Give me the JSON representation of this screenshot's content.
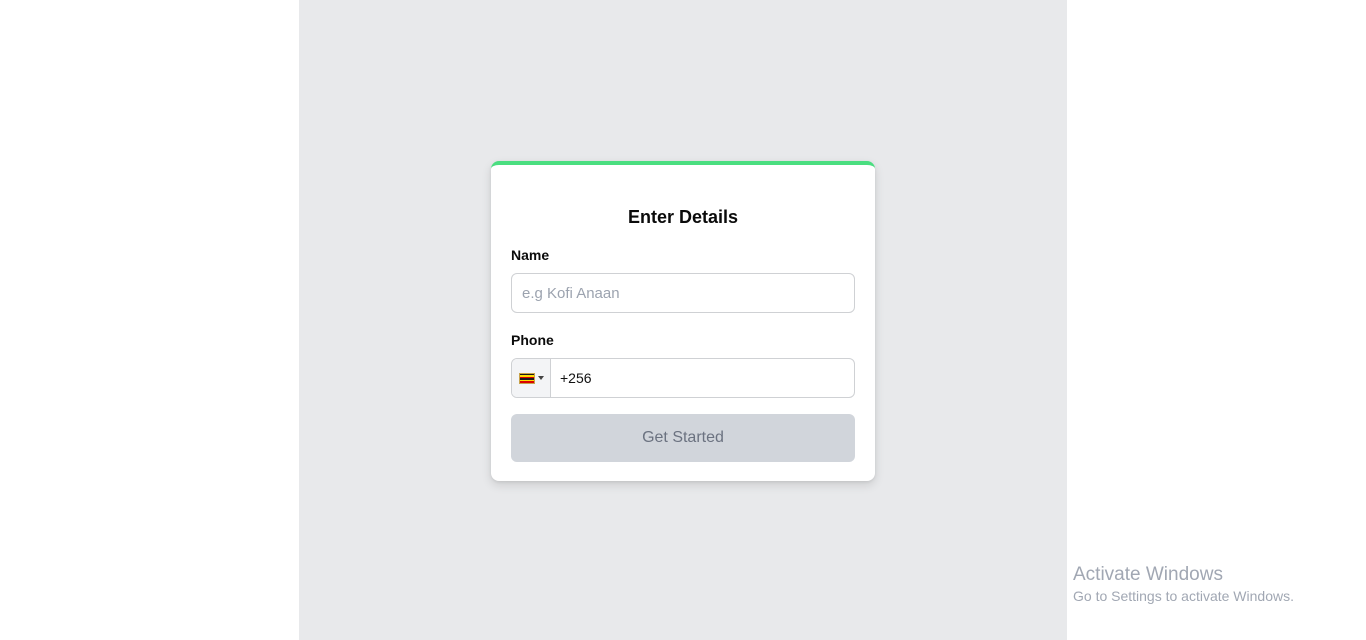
{
  "form": {
    "title": "Enter Details",
    "name_label": "Name",
    "name_placeholder": "e.g Kofi Anaan",
    "name_value": "",
    "phone_label": "Phone",
    "phone_value": "+256",
    "country_flag_icon": "uganda-flag-icon",
    "submit_label": "Get Started",
    "submit_enabled": false
  },
  "colors": {
    "accent_top_border": "#4ade80",
    "button_disabled_bg": "#d1d5db",
    "background": "#e8e9eb"
  },
  "watermark": {
    "title": "Activate Windows",
    "subtitle": "Go to Settings to activate Windows."
  }
}
